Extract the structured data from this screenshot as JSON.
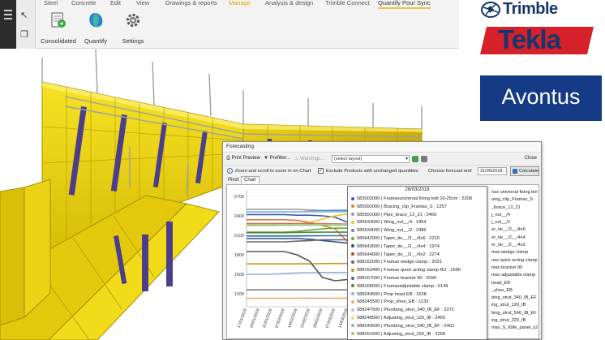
{
  "ribbon": {
    "tabs": [
      {
        "label": "Steel"
      },
      {
        "label": "Concrete"
      },
      {
        "label": "Edit"
      },
      {
        "label": "View"
      },
      {
        "label": "Drawings & reports"
      },
      {
        "label": "Manage"
      },
      {
        "label": "Analysis & design"
      },
      {
        "label": "Trimble Connect"
      },
      {
        "label": "Quantify Pour Sync"
      }
    ],
    "buttons": [
      {
        "label": "Consolidated"
      },
      {
        "label": "Quantify"
      },
      {
        "label": "Settings"
      }
    ]
  },
  "logos": {
    "trimble": "Trimble",
    "tekla": "Tekla",
    "avontus": "Avontus"
  },
  "forecast": {
    "title": "Forecasting",
    "close_label": "Close",
    "print_preview": "Print Preview",
    "prefilter": "Prefilter...",
    "warnings": "Warnings...",
    "layout_select": "(select layout)",
    "zoom_hint": "Zoom and scroll to zoom in on Chart",
    "exclude_label": "Exclude Products with unchanged quantities",
    "exclude_checked": true,
    "forecast_end_label": "Choose forecast end",
    "forecast_end_value": "31/05/2018",
    "calculate_label": "Calculate",
    "subtabs": [
      "Pivot",
      "Chart"
    ],
    "right_legend": [
      "nax universal fixing bol",
      "oing_clip_Framax_S",
      "_brace_12_21",
      "j_nut__/4",
      "j_nut__/2",
      "er_tie__/2__/4x6",
      "er_tie__/2__/4x4",
      "er_tie__/2__/4x2",
      "max wedge clamp",
      "nax quick acting clamp",
      "max bracket 90",
      "max adjustable clamp",
      "head_EB",
      "_shoe_EB",
      "bing_strut_340_IB_EF",
      "ing_strut_120_IB",
      "bing_strut_540_IB_EF",
      "ing_strut_220_IB",
      "max_S_Klife_panel_x2"
    ]
  },
  "tooltip": {
    "date": "26/03/2018",
    "rows": [
      {
        "text": "583002000 | Framaxuniversal fixing bolt 10-25cm : 2208",
        "color": "#3b5ea9"
      },
      {
        "text": "585092000 | Bracing_clip_Framax_S : 1357",
        "color": "#e17b2d"
      },
      {
        "text": "585591000 | Pipe_brace_12_21 : 2469",
        "color": "#999999"
      },
      {
        "text": "585633000 | Wing_nut__/4 : 2454",
        "color": "#e8c52a"
      },
      {
        "text": "585634000 | Wing_nut__/2 : 2485",
        "color": "#4c8fc8"
      },
      {
        "text": "585642000 | Taper_tie__/2__/4x6 : 2210",
        "color": "#69a83b"
      },
      {
        "text": "585643000 | Taper_tie__/2__/4x4 : 1974",
        "color": "#2a4f8c"
      },
      {
        "text": "585644000 | Taper_tie__/2__/4x2 : 2274",
        "color": "#b3471d"
      },
      {
        "text": "588152000 | Framax wedge clamp : 2031",
        "color": "#666666"
      },
      {
        "text": "588153400 | Framax quick acting clamp RU : 1666",
        "color": "#c09a1c"
      },
      {
        "text": "588167000 | Framax bracket 90 : 2094",
        "color": "#2f6aa8"
      },
      {
        "text": "588168000 | Framaxadjustable clamp : 2149",
        "color": "#4d8c2c"
      },
      {
        "text": "588244500 | Prop head EB : 1528",
        "color": "#8fb1e0"
      },
      {
        "text": "588245500 | Prop_shoe_EB : 1133",
        "color": "#f2a96b"
      },
      {
        "text": "588247500 | Plumbing_strut_340_IB_EF : 2271",
        "color": "#c2c2c2"
      },
      {
        "text": "588248500 | Adjusting_strut_120_IB : 2465",
        "color": "#f5d86b"
      },
      {
        "text": "588249500 | Plumbing_strut_540_IB_EF : 2463",
        "color": "#7fb3e8"
      },
      {
        "text": "588251500 | Adjusting_strut_220_IB : 2258",
        "color": "#98c86b"
      }
    ]
  },
  "chart_data": {
    "type": "line",
    "title": "",
    "xlabel": "",
    "ylabel": "",
    "ylim": [
      1000,
      2800
    ],
    "yticks": [
      1200,
      1500,
      1800,
      2100,
      2400,
      2700
    ],
    "x": [
      "17/01/2018",
      "24/01/2018",
      "31/01/2018",
      "07/02/2018",
      "14/02/2018",
      "21/02/2018",
      "28/02/2018",
      "07/03/2018",
      "14/03/2018",
      "21/03/2018",
      "28/03/2018",
      "04/04/2018",
      "11/04/2018",
      "18/04/2018",
      "25/04/2018",
      "02/05/2018",
      "09/05/2018",
      "16/05/2018",
      "23/05/2018",
      "30/05/2018"
    ],
    "series": [
      {
        "color": "#3b5ea9",
        "values": [
          2420,
          2420,
          2420,
          2420,
          2410,
          2410,
          2400,
          2380,
          2300,
          2200,
          2208,
          2250,
          2300,
          2350,
          2380,
          2400,
          2410,
          2420,
          2420,
          2420
        ]
      },
      {
        "color": "#e17b2d",
        "values": [
          2340,
          2340,
          2340,
          2340,
          2330,
          2300,
          2250,
          2200,
          2000,
          1600,
          1357,
          1400,
          1500,
          1700,
          1900,
          2050,
          2150,
          2200,
          2250,
          2260
        ]
      },
      {
        "color": "#999999",
        "values": [
          2500,
          2500,
          2500,
          2500,
          2500,
          2490,
          2480,
          2470,
          2469,
          2469,
          2469,
          2470,
          2480,
          2490,
          2500,
          2500,
          2500,
          2500,
          2500,
          2500
        ]
      },
      {
        "color": "#e8c52a",
        "values": [
          2250,
          2250,
          2250,
          2260,
          2270,
          2300,
          2350,
          2400,
          2430,
          2450,
          2454,
          2454,
          2454,
          2454,
          2454,
          2460,
          2460,
          2460,
          2460,
          2460
        ]
      },
      {
        "color": "#4c8fc8",
        "values": [
          2460,
          2460,
          2460,
          2460,
          2460,
          2470,
          2480,
          2485,
          2485,
          2485,
          2485,
          2485,
          2485,
          2485,
          2485,
          2485,
          2485,
          2485,
          2485,
          2485
        ]
      },
      {
        "color": "#69a83b",
        "values": [
          2150,
          2150,
          2150,
          2150,
          2160,
          2180,
          2200,
          2210,
          2210,
          2210,
          2210,
          2210,
          2210,
          2200,
          2190,
          2180,
          2170,
          2160,
          2150,
          2150
        ]
      },
      {
        "color": "#2a4f8c",
        "values": [
          2050,
          2050,
          2050,
          2050,
          2050,
          2040,
          2020,
          2000,
          1980,
          1974,
          1974,
          1974,
          1974,
          1974,
          1974,
          1980,
          1990,
          2000,
          2010,
          2020
        ]
      },
      {
        "color": "#b3471d",
        "values": [
          2280,
          2280,
          2280,
          2280,
          2280,
          2280,
          2280,
          2278,
          2275,
          2274,
          2274,
          2274,
          2274,
          2274,
          2274,
          2274,
          2274,
          2274,
          2274,
          2274
        ]
      },
      {
        "color": "#666666",
        "values": [
          2000,
          2000,
          2000,
          2000,
          2010,
          2020,
          2030,
          2031,
          2031,
          2031,
          2031,
          2031,
          2031,
          2031,
          2031,
          2031,
          2031,
          2031,
          2031,
          2031
        ]
      },
      {
        "color": "#c09a1c",
        "values": [
          1660,
          1660,
          1660,
          1660,
          1660,
          1660,
          1665,
          1666,
          1666,
          1666,
          1666,
          1666,
          1666,
          1666,
          1666,
          1666,
          1666,
          1666,
          1666,
          1666
        ]
      },
      {
        "color": "#2f6aa8",
        "values": [
          2090,
          2090,
          2090,
          2090,
          2090,
          2092,
          2094,
          2094,
          2094,
          2094,
          2094,
          2094,
          2094,
          2094,
          2094,
          2094,
          2094,
          2094,
          2094,
          2094
        ]
      },
      {
        "color": "#4d8c2c",
        "values": [
          2140,
          2140,
          2140,
          2140,
          2145,
          2148,
          2149,
          2149,
          2149,
          2149,
          2149,
          2149,
          2149,
          2149,
          2149,
          2149,
          2149,
          2149,
          2149,
          2149
        ]
      },
      {
        "color": "#8fb1e0",
        "values": [
          1500,
          1500,
          1500,
          1510,
          1520,
          1525,
          1528,
          1528,
          1528,
          1528,
          1528,
          1528,
          1528,
          1528,
          1528,
          1528,
          1528,
          1528,
          1528,
          1528
        ]
      },
      {
        "color": "#f2a96b",
        "values": [
          1130,
          1130,
          1130,
          1130,
          1130,
          1132,
          1133,
          1133,
          1133,
          1133,
          1133,
          1133,
          1133,
          1133,
          1133,
          1133,
          1133,
          1133,
          1133,
          1133
        ]
      },
      {
        "color": "#c2c2c2",
        "values": [
          2270,
          2270,
          2270,
          2270,
          2270,
          2270,
          2271,
          2271,
          2271,
          2271,
          2271,
          2271,
          2271,
          2271,
          2271,
          2271,
          2271,
          2271,
          2271,
          2271
        ]
      },
      {
        "color": "#f5d86b",
        "values": [
          2460,
          2460,
          2460,
          2460,
          2462,
          2464,
          2465,
          2465,
          2465,
          2465,
          2465,
          2465,
          2465,
          2465,
          2465,
          2465,
          2465,
          2465,
          2465,
          2465
        ]
      },
      {
        "color": "#7fb3e8",
        "values": [
          2460,
          2460,
          2460,
          2460,
          2461,
          2462,
          2463,
          2463,
          2463,
          2463,
          2463,
          2463,
          2463,
          2463,
          2463,
          2463,
          2463,
          2463,
          2463,
          2463
        ]
      },
      {
        "color": "#98c86b",
        "values": [
          2255,
          2255,
          2255,
          2255,
          2256,
          2257,
          2258,
          2258,
          2258,
          2258,
          2258,
          2258,
          2258,
          2258,
          2258,
          2258,
          2258,
          2258,
          2258,
          2258
        ]
      },
      {
        "color": "#555555",
        "values": [
          1850,
          1850,
          1850,
          1850,
          1800,
          1700,
          1450,
          1400,
          1420,
          1450,
          1500,
          1600,
          1700,
          1750,
          1800,
          1800,
          1800,
          1800,
          1800,
          1800
        ]
      },
      {
        "color": "#7a7a7a",
        "values": [
          1260,
          1260,
          1260,
          1260,
          1260,
          1260,
          1260,
          1260,
          1260,
          1260,
          1260,
          1260,
          1260,
          1260,
          1260,
          1260,
          1260,
          1260,
          1260,
          1260
        ]
      }
    ]
  }
}
